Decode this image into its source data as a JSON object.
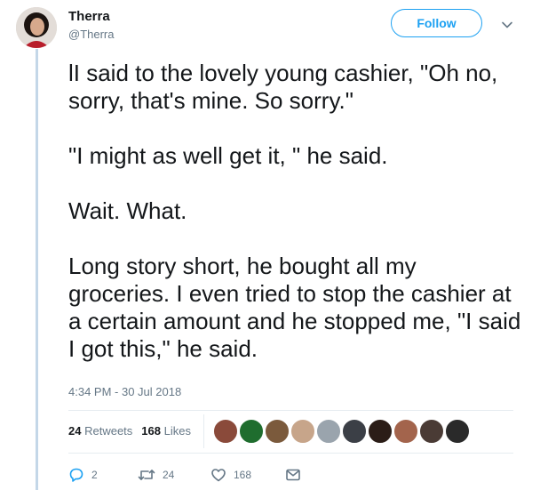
{
  "tweet": {
    "display_name": "Therra",
    "handle": "@Therra",
    "follow_label": "Follow",
    "paragraphs": [
      "lI said to the lovely young cashier, \"Oh no, sorry, that's mine. So sorry.\"",
      "\"I might as well get it, \" he said.",
      "Wait. What.",
      "Long story short, he bought all my groceries. I even tried to stop the cashier at a certain amount and he stopped me, \"I said I got this,\" he said."
    ],
    "timestamp": "4:34 PM - 30 Jul 2018"
  },
  "stats": {
    "retweets_count": "24",
    "retweets_label": "Retweets",
    "likes_count": "168",
    "likes_label": "Likes"
  },
  "likers": [
    {
      "color": "#8a4a3a"
    },
    {
      "color": "#1f6d2e"
    },
    {
      "color": "#7b5a3c"
    },
    {
      "color": "#c7a58a"
    },
    {
      "color": "#9aa4ad"
    },
    {
      "color": "#3b3f46"
    },
    {
      "color": "#2b1d17"
    },
    {
      "color": "#a3644c"
    },
    {
      "color": "#4a3b35"
    },
    {
      "color": "#2a2a2a"
    }
  ],
  "actions": {
    "reply_count": "2",
    "retweet_count": "24",
    "like_count": "168"
  },
  "colors": {
    "accent": "#1da1f2",
    "muted": "#657786",
    "text": "#14171a",
    "thread": "#c4d7e8"
  },
  "icons": {
    "caret": "chevron-down-icon",
    "reply": "reply-icon",
    "retweet": "retweet-icon",
    "like": "heart-icon",
    "message": "envelope-icon"
  }
}
